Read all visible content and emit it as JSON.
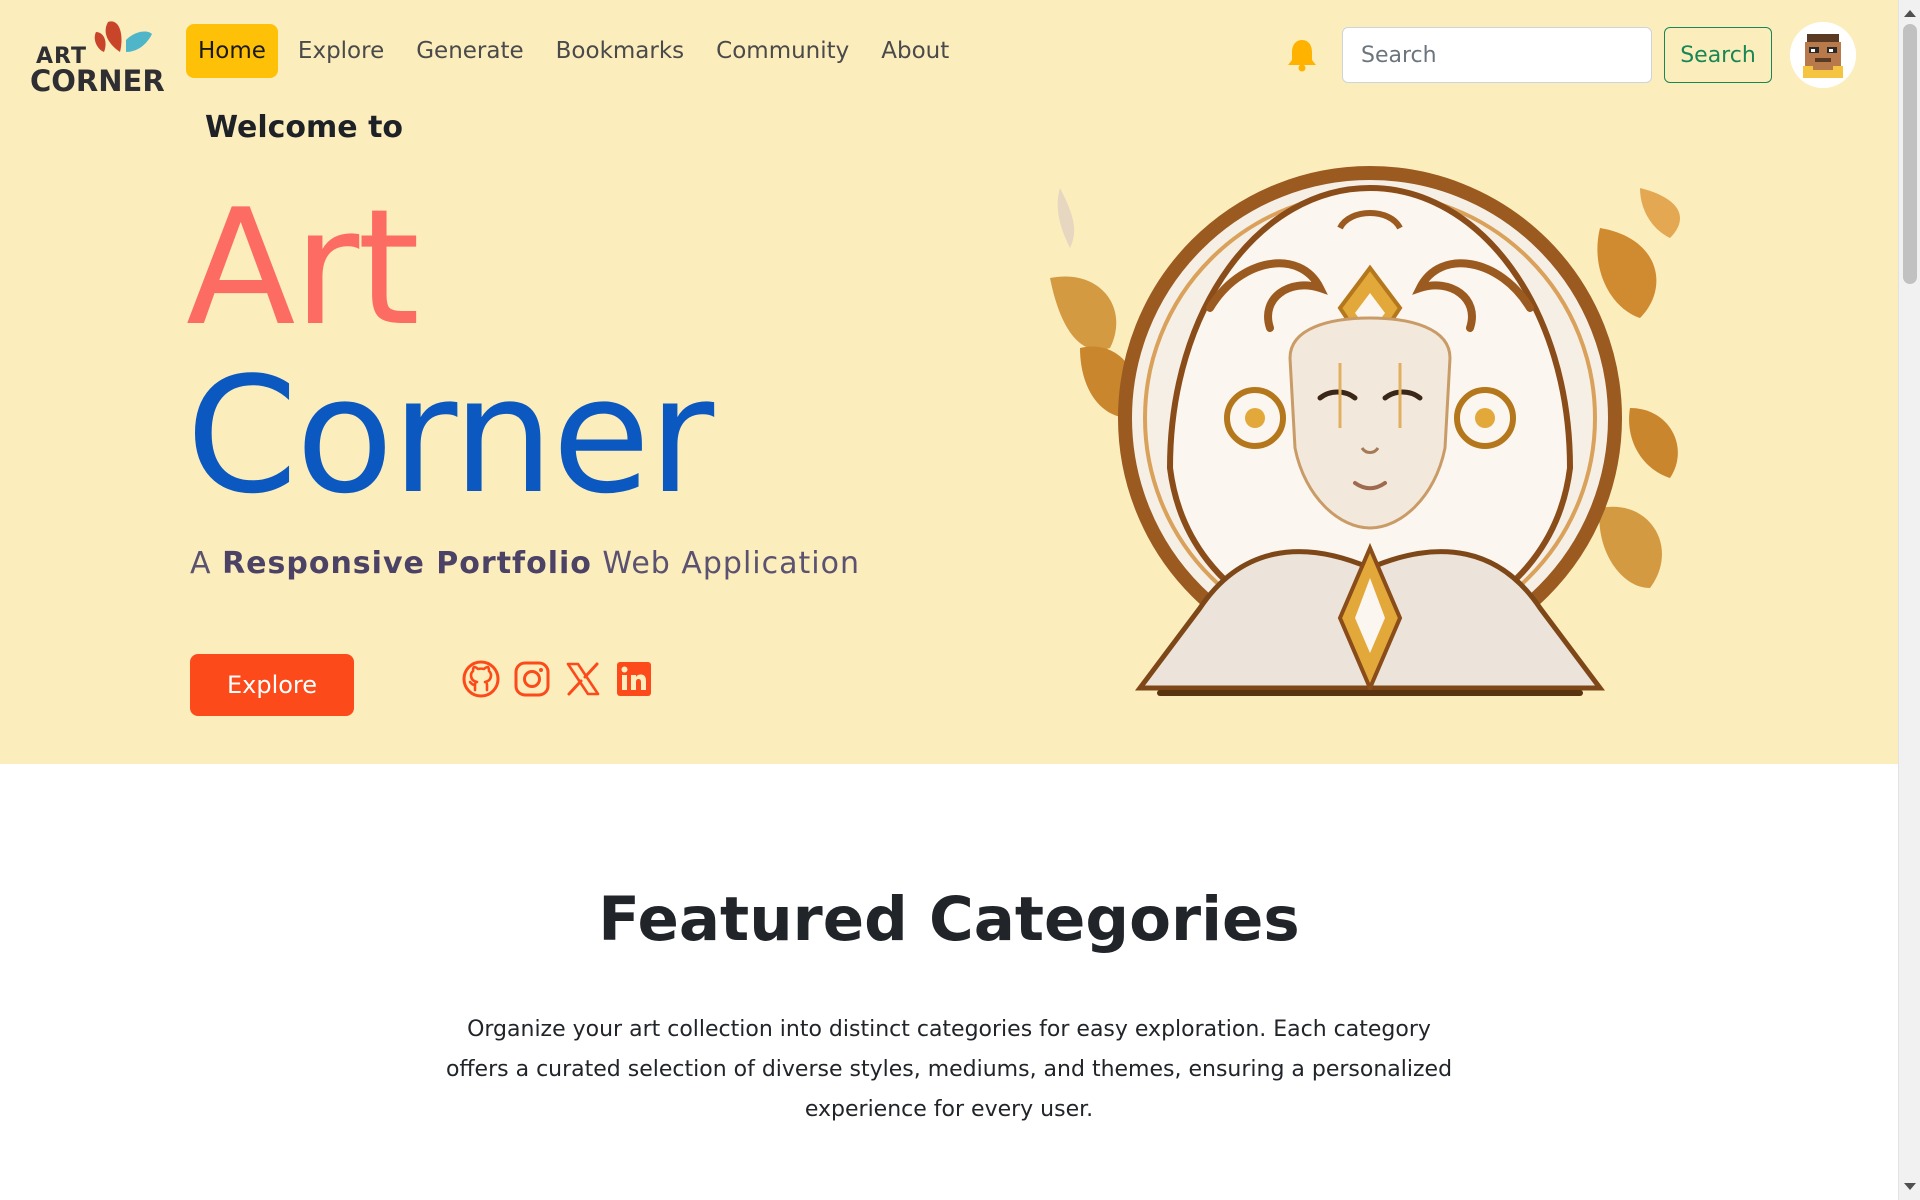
{
  "brand": {
    "logo_line1": "ART",
    "logo_line2": "CORNER",
    "colors": {
      "red_leaf": "#c9452a",
      "teal_leaf": "#4fb6c9",
      "text": "#2f2f33"
    }
  },
  "nav": {
    "items": [
      {
        "label": "Home",
        "active": true
      },
      {
        "label": "Explore",
        "active": false
      },
      {
        "label": "Generate",
        "active": false
      },
      {
        "label": "Bookmarks",
        "active": false
      },
      {
        "label": "Community",
        "active": false
      },
      {
        "label": "About",
        "active": false
      }
    ],
    "active_color": "#ffc107",
    "notification_icon": "bell-icon",
    "search": {
      "placeholder": "Search",
      "value": "",
      "button_label": "Search"
    },
    "avatar_icon": "pixel-avatar-icon"
  },
  "hero": {
    "welcome": "Welcome to",
    "title_line1": "Art",
    "title_line2": "Corner",
    "tagline_prefix": "A ",
    "tagline_bold": "Responsive Portfolio",
    "tagline_suffix": " Web Application",
    "explore_label": "Explore",
    "socials": [
      "github-icon",
      "instagram-icon",
      "x-icon",
      "linkedin-icon"
    ],
    "colors": {
      "background": "#fcedbd",
      "art": "#fd6c62",
      "corner": "#0b59c0",
      "button": "#fc4a1a",
      "social": "#fc4a1a"
    }
  },
  "featured": {
    "title": "Featured Categories",
    "description": "Organize your art collection into distinct categories for easy exploration. Each category offers a curated selection of diverse styles, mediums, and themes, ensuring a personalized experience for every user."
  }
}
